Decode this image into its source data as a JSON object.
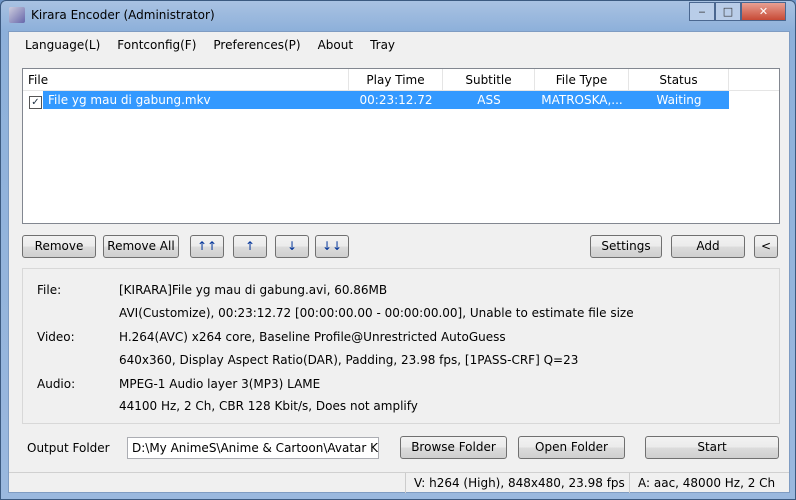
{
  "window": {
    "title": "Kirara Encoder (Administrator)",
    "minimize": "‒",
    "maximize": "□",
    "close": "✕"
  },
  "menu": [
    "Language(L)",
    "Fontconfig(F)",
    "Preferences(P)",
    "About",
    "Tray"
  ],
  "list": {
    "columns": [
      "File",
      "Play Time",
      "Subtitle",
      "File Type",
      "Status"
    ],
    "rows": [
      {
        "checked": true,
        "file": "File yg mau di gabung.mkv",
        "play_time": "00:23:12.72",
        "subtitle": "ASS",
        "file_type": "MATROSKA,...",
        "status": "Waiting"
      }
    ]
  },
  "buttons": {
    "remove": "Remove",
    "remove_all": "Remove All",
    "top": "↑↑",
    "up": "↑",
    "down": "↓",
    "bottom": "↓↓",
    "settings": "Settings",
    "add": "Add",
    "collapse": "<",
    "browse": "Browse Folder",
    "open": "Open Folder",
    "start": "Start"
  },
  "info": {
    "file_label": "File:",
    "file_line1": "[KIRARA]File yg mau di gabung.avi, 60.86MB",
    "file_line2": "AVI(Customize), 00:23:12.72 [00:00:00.00 - 00:00:00.00], Unable to estimate file size",
    "video_label": "Video:",
    "video_line1": "H.264(AVC) x264 core, Baseline Profile@Unrestricted AutoGuess",
    "video_line2": "640x360, Display Aspect Ratio(DAR), Padding, 23.98 fps, [1PASS-CRF] Q=23",
    "audio_label": "Audio:",
    "audio_line1": "MPEG-1 Audio layer 3(MP3) LAME",
    "audio_line2": "44100 Hz, 2 Ch, CBR 128 Kbit/s, Does not amplify"
  },
  "output": {
    "label": "Output Folder",
    "value": "D:\\My AnimeS\\Anime & Cartoon\\Avatar Korra"
  },
  "status": {
    "video": "V: h264 (High), 848x480, 23.98 fps",
    "audio": "A: aac, 48000 Hz, 2 Ch"
  }
}
